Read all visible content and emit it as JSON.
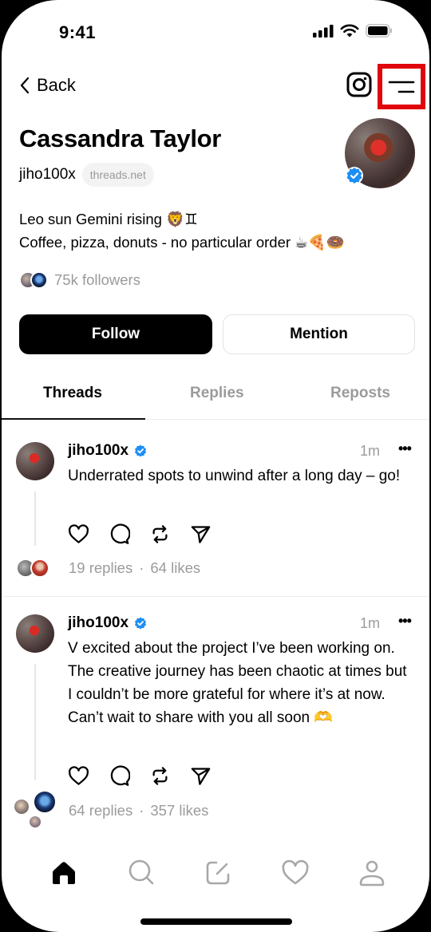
{
  "status_bar": {
    "time": "9:41"
  },
  "nav": {
    "back_label": "Back",
    "instagram_icon": "instagram-icon",
    "menu_icon": "menu-icon",
    "highlight_color": "#e0060c"
  },
  "profile": {
    "name": "Cassandra Taylor",
    "handle": "jiho100x",
    "domain_chip": "threads.net",
    "verified": true,
    "bio_lines": [
      "Leo sun Gemini rising 🦁♊",
      "Coffee, pizza, donuts - no particular order ☕🍕🍩"
    ],
    "followers": "75k followers"
  },
  "actions": {
    "follow_label": "Follow",
    "mention_label": "Mention"
  },
  "tabs": [
    {
      "label": "Threads",
      "active": true
    },
    {
      "label": "Replies",
      "active": false
    },
    {
      "label": "Reposts",
      "active": false
    }
  ],
  "posts": [
    {
      "username": "jiho100x",
      "verified": true,
      "time": "1m",
      "more": "•••",
      "text": "Underrated spots to unwind after a long day – go!",
      "replies": "19 replies",
      "separator": "·",
      "likes": "64 likes"
    },
    {
      "username": "jiho100x",
      "verified": true,
      "time": "1m",
      "more": "•••",
      "text": "V excited about the project I’ve been working on. The creative journey has been chaotic at times but I couldn’t be more grateful for where it’s at now. Can’t wait to share with you all soon 🫶",
      "replies": "64 replies",
      "separator": "·",
      "likes": "357 likes"
    }
  ],
  "bottom_nav": [
    {
      "name": "home",
      "active": true
    },
    {
      "name": "search",
      "active": false
    },
    {
      "name": "compose",
      "active": false
    },
    {
      "name": "activity",
      "active": false
    },
    {
      "name": "profile",
      "active": false
    }
  ],
  "colors": {
    "verified_blue": "#1d8ef5",
    "muted_text": "#9b9b9b",
    "primary": "#000000"
  }
}
